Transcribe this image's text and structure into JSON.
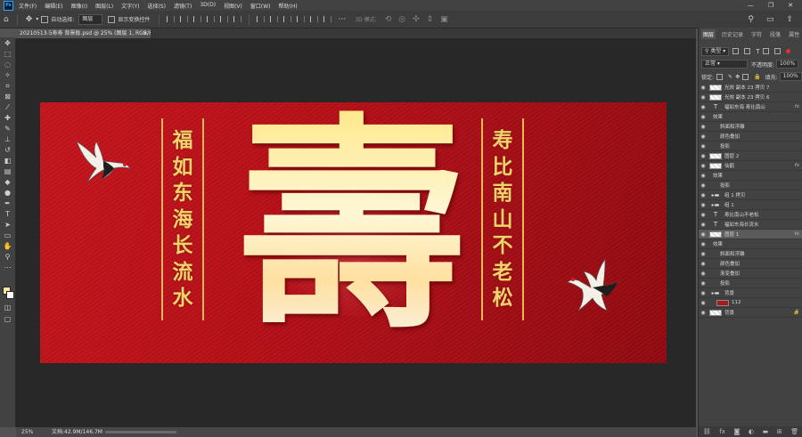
{
  "menubar": {
    "items": [
      "文件(F)",
      "编辑(E)",
      "图像(I)",
      "图层(L)",
      "文字(Y)",
      "选择(S)",
      "滤镜(T)",
      "3D(D)",
      "视图(V)",
      "窗口(W)",
      "帮助(H)"
    ],
    "controls": [
      "—",
      "❐",
      "✕"
    ]
  },
  "options": {
    "auto_select_label": "自动选择:",
    "auto_select_value": "图层",
    "show_transform_label": "显示变换控件",
    "mode_3d_label": "3D 模式:"
  },
  "document": {
    "tab_title": "20210513-5寿寿 背景板.psd @ 25% (图层 1, RGB/8)",
    "zoom": "25%",
    "doc_info": "文档:42.9M/146.7M"
  },
  "artboard": {
    "main_character": "壽",
    "left_couplet": [
      "福",
      "如",
      "东",
      "海",
      "长",
      "流",
      "水"
    ],
    "right_couplet": [
      "寿",
      "比",
      "南",
      "山",
      "不",
      "老",
      "松"
    ]
  },
  "panel": {
    "tabs": [
      "图层",
      "历史记录",
      "字符",
      "段落",
      "属性"
    ],
    "kind_label": "类型",
    "blend_mode": "正常",
    "opacity_label": "不透明度:",
    "opacity_value": "100%",
    "lock_label": "锁定:",
    "fill_label": "填充:",
    "fill_value": "100%"
  },
  "layers": [
    {
      "type": "raster",
      "name": "光效 副本 23 拷贝 7",
      "fx": false,
      "indent": 0
    },
    {
      "type": "raster",
      "name": "光效 副本 23 拷贝 6",
      "fx": false,
      "indent": 0
    },
    {
      "type": "text",
      "name": "福如东海 寿比南山",
      "fx": true,
      "indent": 0
    },
    {
      "type": "effects",
      "name": "效果",
      "indent": 1
    },
    {
      "type": "effect",
      "name": "斜面和浮雕",
      "indent": 2
    },
    {
      "type": "effect",
      "name": "颜色叠加",
      "indent": 2
    },
    {
      "type": "effect",
      "name": "投影",
      "indent": 2
    },
    {
      "type": "raster",
      "name": "图层 2",
      "fx": false,
      "indent": 0
    },
    {
      "type": "raster",
      "name": "仙鹤",
      "fx": true,
      "indent": 0
    },
    {
      "type": "effects",
      "name": "效果",
      "indent": 1
    },
    {
      "type": "effect",
      "name": "投影",
      "indent": 2
    },
    {
      "type": "group",
      "name": "组 1 拷贝",
      "fx": false,
      "indent": 0
    },
    {
      "type": "group",
      "name": "组 1",
      "fx": false,
      "indent": 0
    },
    {
      "type": "text",
      "name": "寿比南山不老松",
      "fx": false,
      "indent": 0
    },
    {
      "type": "text",
      "name": "福如东海长流水",
      "fx": false,
      "indent": 0
    },
    {
      "type": "raster",
      "name": "图层 1",
      "fx": true,
      "indent": 0,
      "selected": true
    },
    {
      "type": "effects",
      "name": "效果",
      "indent": 1
    },
    {
      "type": "effect",
      "name": "斜面和浮雕",
      "indent": 2
    },
    {
      "type": "effect",
      "name": "颜色叠加",
      "indent": 2
    },
    {
      "type": "effect",
      "name": "渐变叠加",
      "indent": 2
    },
    {
      "type": "effect",
      "name": "投影",
      "indent": 2
    },
    {
      "type": "group",
      "name": "背景",
      "fx": false,
      "indent": 0
    },
    {
      "type": "raster",
      "name": "112",
      "fx": false,
      "indent": 1,
      "thumb": "#a8181c"
    },
    {
      "type": "raster",
      "name": "背景",
      "fx": false,
      "indent": 0,
      "locked": true
    }
  ],
  "colors": {
    "accent": "#31a8ff",
    "background_red": "#b3121a",
    "gold": "#f6d16e",
    "foreground_swatch": "#f5e6a0",
    "background_swatch": "#ffffff"
  }
}
